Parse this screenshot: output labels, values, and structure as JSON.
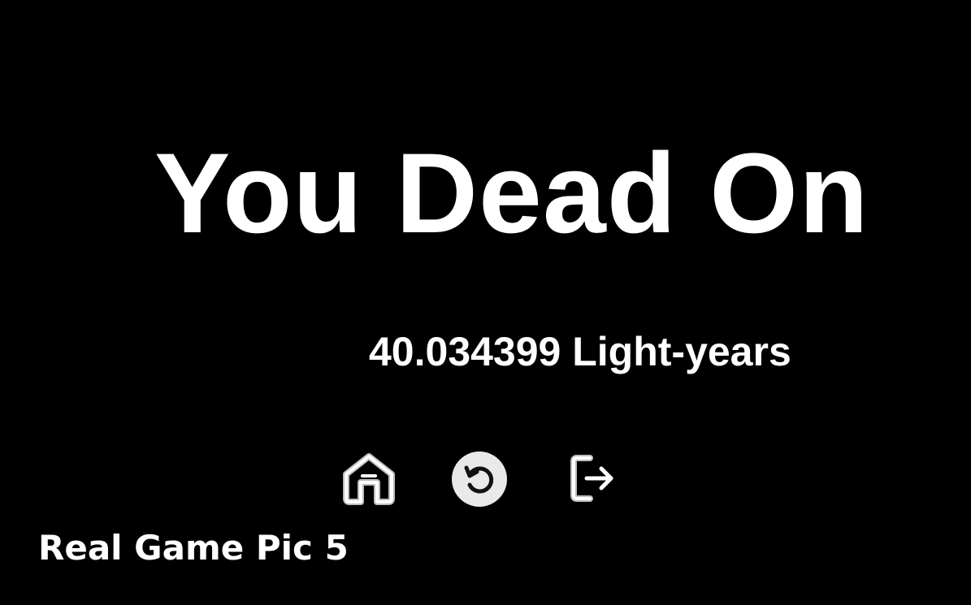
{
  "game_over": {
    "title": "You Dead On",
    "distance": "40.034399 Light-years"
  },
  "actions": {
    "home_icon": "home-icon",
    "restart_icon": "restart-icon",
    "exit_icon": "exit-icon"
  },
  "caption": "Real Game Pic 5",
  "colors": {
    "background": "#000000",
    "text": "#ffffff",
    "icon_outline": "#bdbdbd"
  }
}
